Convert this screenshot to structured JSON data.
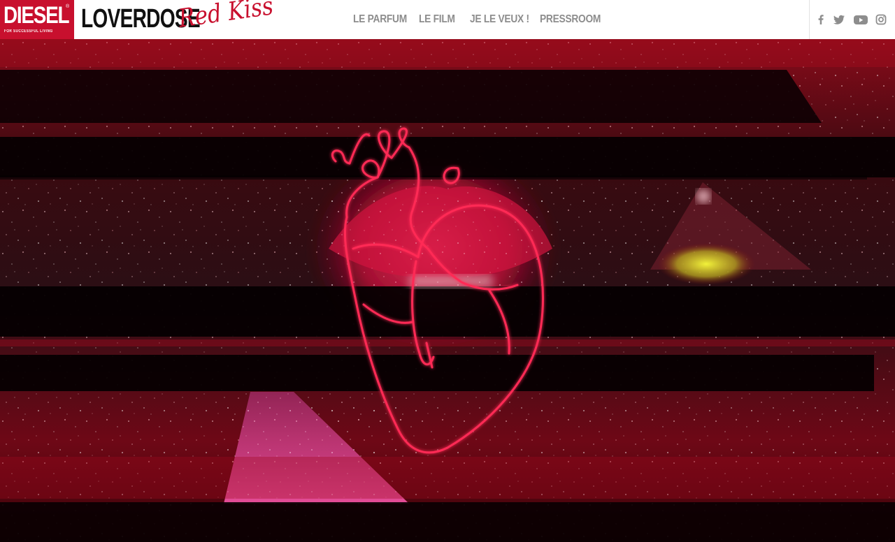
{
  "header": {
    "logo": {
      "word": "DIESEL",
      "registered": "®",
      "tagline": "FOR SUCCESSFUL LIVING"
    },
    "title": "LOVERDOSE",
    "subtitle_script": "Red Kiss"
  },
  "nav": {
    "items": [
      {
        "label": "LE PARFUM"
      },
      {
        "label": "LE FILM"
      },
      {
        "label": "JE LE VEUX !"
      },
      {
        "label": "PRESSROOM"
      }
    ]
  },
  "social": {
    "icons": [
      "facebook-icon",
      "twitter-icon",
      "youtube-icon",
      "instagram-icon"
    ]
  },
  "colors": {
    "brand_red": "#c8102e",
    "nav_gray": "#8d8d8d",
    "neon_heart": "#ff2a55",
    "hero_dark": "#1a0004"
  }
}
